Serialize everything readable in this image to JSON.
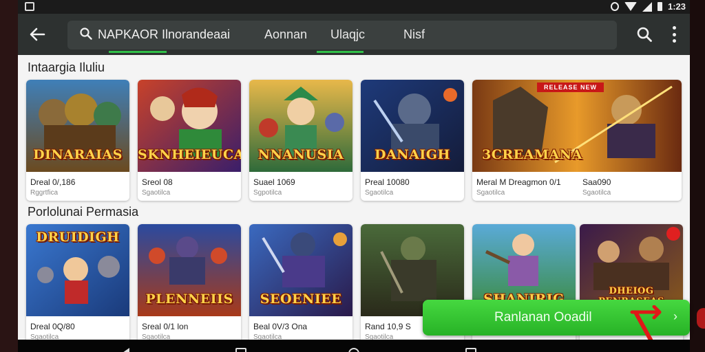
{
  "status_bar": {
    "time": "1:23"
  },
  "app_bar": {
    "search_text": "NAPKAOR Ilnorandeaai",
    "tabs": [
      {
        "label": "Aonnan"
      },
      {
        "label": "Ulaqjc"
      },
      {
        "label": "Nisf"
      }
    ]
  },
  "sections": [
    {
      "title": "Intaargia Iluliu",
      "cards": [
        {
          "art_title": "DINARAIAS",
          "name": "Dreal 0/,186",
          "sub": "Rggrtfica"
        },
        {
          "art_title": "SKNHEIEUCA",
          "name": "Sreol 08",
          "sub": "Sgaotilca"
        },
        {
          "art_title": "NNANUSIA",
          "name": "Suael 1069",
          "sub": "Sgpotilca"
        },
        {
          "art_title": "DANAIGH",
          "name": "Preal 10080",
          "sub": "Sgaotilca"
        },
        {
          "art_title": "3CREAMANA",
          "name": "Meral M Dreagmon 0/1",
          "sub": "Sgaotilca",
          "banner": "RELEASE NEW"
        },
        {
          "art_title": "",
          "name": "Saa090",
          "sub": "Sgaotilca"
        }
      ]
    },
    {
      "title": "Porlolunai Permasia",
      "cards": [
        {
          "art_title": "DRUIDIGH",
          "name": "Dreal 0Q/80",
          "sub": "Sgaotilca"
        },
        {
          "art_title": "PLENNEIIS",
          "name": "Sreal 0/1 lon",
          "sub": "Sgaotilca"
        },
        {
          "art_title": "SEOENIEE",
          "name": "Beal 0V/3 Ona",
          "sub": "Sgaotilca"
        },
        {
          "art_title": "",
          "name": "Rand 10,9 S",
          "sub": "Sgaotilca"
        },
        {
          "art_title": "SHANIRIG",
          "name": "",
          "sub": ""
        },
        {
          "art_title": "DHEIOG PENRASEAS",
          "name": "",
          "sub": ""
        }
      ]
    }
  ],
  "install_button": {
    "label": "Ranlanan Ooadil"
  },
  "colors": {
    "accent_green": "#2fbf3a",
    "appbar": "#2d3130",
    "badge_red": "#c81818"
  }
}
